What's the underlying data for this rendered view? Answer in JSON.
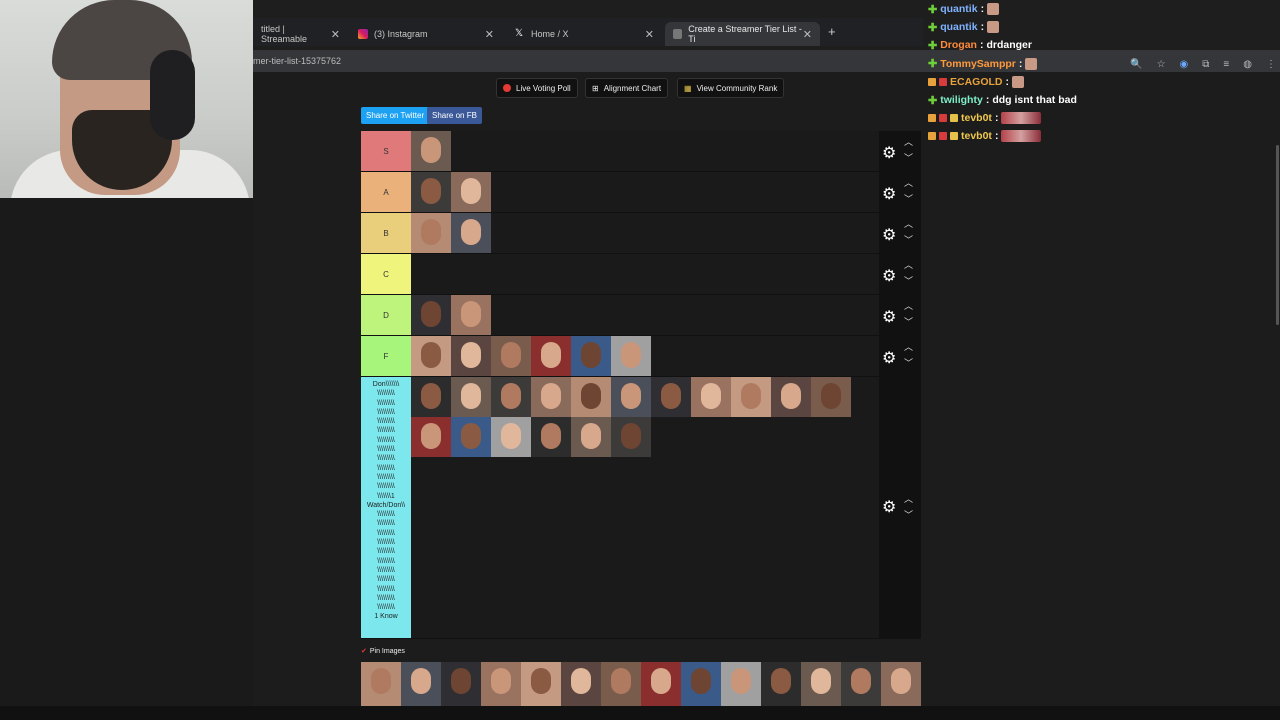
{
  "browser": {
    "tabs": [
      {
        "label": "titled | Streamable",
        "icon": "streamable-icon"
      },
      {
        "label": "(3) Instagram",
        "icon": "instagram-icon"
      },
      {
        "label": "Home / X",
        "icon": "x-icon"
      },
      {
        "label": "Create a Streamer Tier List - Ti",
        "icon": "tiermaker-icon"
      }
    ],
    "address": "mer-tier-list-15375762",
    "newtab": "+"
  },
  "toolbar": {
    "live_voting": "Live Voting Poll",
    "alignment": "Alignment Chart",
    "community": "View Community Rank",
    "share_twitter": "Share on Twitter",
    "share_fb": "Share on FB"
  },
  "tiers": [
    {
      "label": "S",
      "color": "#e07a7a",
      "count": 1
    },
    {
      "label": "A",
      "color": "#eab17a",
      "count": 2
    },
    {
      "label": "B",
      "color": "#e9cf7c",
      "count": 2
    },
    {
      "label": "C",
      "color": "#eef47c",
      "count": 0
    },
    {
      "label": "D",
      "color": "#bff47c",
      "count": 2
    },
    {
      "label": "F",
      "color": "#a8f57c",
      "count": 6
    }
  ],
  "last_tier": {
    "label_lines": [
      "Don\\\\\\\\\\\\\\",
      "\\\\\\\\\\\\\\\\\\",
      "\\\\\\\\\\\\\\\\\\",
      "\\\\\\\\\\\\\\\\\\",
      "\\\\\\\\\\\\\\\\\\",
      "\\\\\\\\\\\\\\\\\\",
      "\\\\\\\\\\\\\\\\\\",
      "\\\\\\\\\\\\\\\\\\",
      "\\\\\\\\\\\\\\\\\\",
      "\\\\\\\\\\\\\\\\\\",
      "\\\\\\\\\\\\\\\\\\",
      "\\\\\\\\\\\\\\\\\\",
      "\\\\\\\\\\\\\\1",
      "Watch/Don\\\\",
      "\\\\\\\\\\\\\\\\\\",
      "\\\\\\\\\\\\\\\\\\",
      "\\\\\\\\\\\\\\\\\\",
      "\\\\\\\\\\\\\\\\\\",
      "\\\\\\\\\\\\\\\\\\",
      "\\\\\\\\\\\\\\\\\\",
      "\\\\\\\\\\\\\\\\\\",
      "\\\\\\\\\\\\\\\\\\",
      "\\\\\\\\\\\\\\\\\\",
      "\\\\\\\\\\\\\\\\\\",
      "\\\\\\\\\\\\\\\\\\",
      "1 Know"
    ],
    "color": "#7ce8ee",
    "count": 17
  },
  "pin_images": "Pin Images",
  "pin_count": 14,
  "chat": [
    {
      "user": "quantik",
      "color": "#7fb3ff",
      "msg": "",
      "emote": "emote",
      "badges": 0
    },
    {
      "user": "quantik",
      "color": "#7fb3ff",
      "msg": "",
      "emote": "emote",
      "badges": 0
    },
    {
      "user": "Drogan",
      "color": "#ff8c3a",
      "msg": "drdanger",
      "emote": "",
      "badges": 0
    },
    {
      "user": "TommySamppr",
      "color": "#ff9a3c",
      "msg": "",
      "emote": "emote",
      "badges": 0
    },
    {
      "user": "ECAGOLD",
      "color": "#e8a23c",
      "msg": "",
      "emote": "emote",
      "badges": 2
    },
    {
      "user": "twilighty",
      "color": "#7df0c8",
      "msg": "ddg isnt that bad",
      "emote": "",
      "badges": 0
    },
    {
      "user": "tevb0t",
      "color": "#f0c84b",
      "msg": "",
      "emote": "wide",
      "badges": 3
    },
    {
      "user": "tevb0t",
      "color": "#f0c84b",
      "msg": "",
      "emote": "wide",
      "badges": 3
    }
  ]
}
